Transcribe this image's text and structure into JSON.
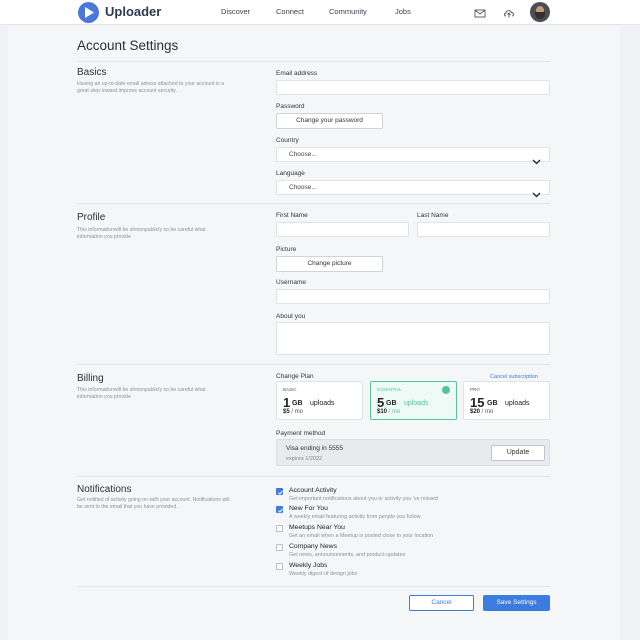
{
  "header": {
    "brand": "Uploader",
    "nav": [
      "Discover",
      "Connect",
      "Community",
      "Jobs"
    ]
  },
  "page": {
    "title": "Account Settings"
  },
  "basics": {
    "title": "Basics",
    "description": "Having an up-to-date email adress attached to your account is a great step toward improve account security.",
    "email_label": "Email address",
    "password_label": "Password",
    "change_password": "Change your password",
    "country_label": "Country",
    "country_placeholder": "Choose...",
    "language_label": "Language",
    "language_placeholder": "Choose..."
  },
  "profile": {
    "title": "Profile",
    "description": "This informationwill be shownpublicly so be careful what information you provide",
    "first_name_label": "First Name",
    "last_name_label": "Last Name",
    "picture_label": "Picture",
    "change_picture": "Change picture",
    "username_label": "Username",
    "about_label": "About you"
  },
  "billing": {
    "title": "Billing",
    "description": "This informationwill be shownpublicly so be careful what information you provide",
    "change_plan_label": "Change Plan",
    "cancel_subscription": "Cancel subscription",
    "plans": [
      {
        "tag": "BASIC",
        "size": "1",
        "unit": "GB",
        "uploads": "uploads",
        "price": "$5",
        "period": " / mo",
        "selected": false
      },
      {
        "tag": "ESSENTIAL",
        "size": "5",
        "unit": "GB",
        "uploads": "uploads",
        "price": "$10",
        "period": " / mo",
        "selected": true
      },
      {
        "tag": "PRO",
        "size": "15",
        "unit": "GB",
        "uploads": "uploads",
        "price": "$20",
        "period": " / mo",
        "selected": false
      }
    ],
    "payment_label": "Payment method",
    "card": "Visa ending in 5555",
    "expires": "expires 1/2022",
    "update": "Update"
  },
  "notifications": {
    "title": "Notifications",
    "description": "Get notified of activity going on with your account. Notifications will be sent to the email that you have provided.",
    "items": [
      {
        "title": "Account Activity",
        "desc": "Get important notifications about you or activity you 've missed",
        "checked": true
      },
      {
        "title": "New For You",
        "desc": "A weekly email featuring activity from people you follow",
        "checked": true
      },
      {
        "title": "Meetups Near You",
        "desc": "Get an email when a Meetup is posted close to your location",
        "checked": false
      },
      {
        "title": "Company News",
        "desc": "Get news, announcements, and product updates",
        "checked": false
      },
      {
        "title": "Weekly Jobs",
        "desc": "Weekly digest of design jobs",
        "checked": false
      }
    ]
  },
  "actions": {
    "cancel": "Cancel",
    "save": "Save Settings"
  },
  "colors": {
    "accent": "#3c7be0",
    "success": "#57c39a",
    "brand": "#4a78d8"
  }
}
